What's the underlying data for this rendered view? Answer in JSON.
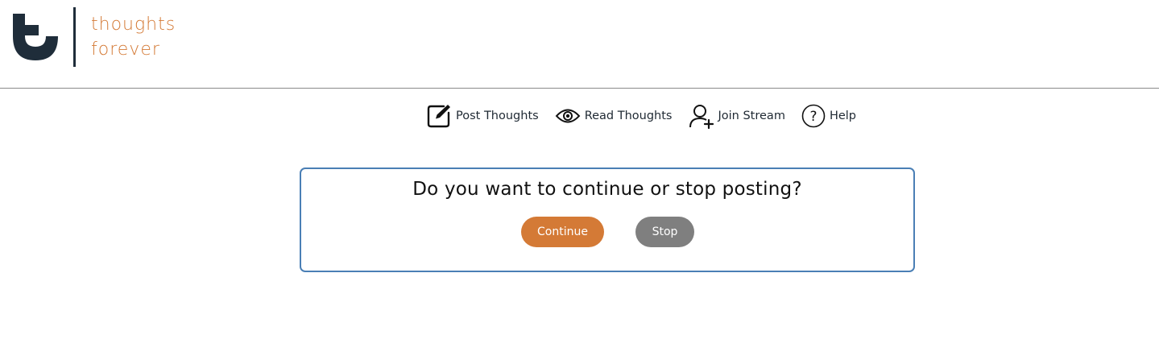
{
  "brand": {
    "line1": "thoughts",
    "line2": "forever",
    "accent_color": "#d47a36",
    "mark_color": "#1f2d3a"
  },
  "nav": {
    "items": [
      {
        "label": "Post Thoughts",
        "icon": "edit-icon"
      },
      {
        "label": "Read Thoughts",
        "icon": "eye-icon"
      },
      {
        "label": "Join Stream",
        "icon": "add-user-icon"
      },
      {
        "label": "Help",
        "icon": "help-icon"
      }
    ]
  },
  "dialog": {
    "question": "Do you want to continue or stop posting?",
    "continue_label": "Continue",
    "stop_label": "Stop",
    "border_color": "#4a7fb5",
    "continue_color": "#d47a36",
    "stop_color": "#7f7f7f"
  }
}
